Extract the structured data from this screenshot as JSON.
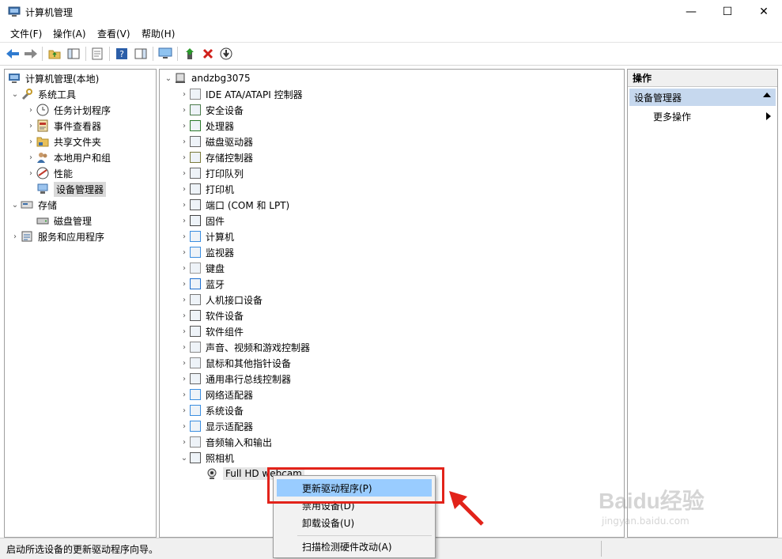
{
  "window": {
    "title": "计算机管理",
    "minimize_glyph": "—",
    "maximize_glyph": "☐",
    "close_glyph": "✕"
  },
  "menubar": {
    "items": [
      "文件(F)",
      "操作(A)",
      "查看(V)",
      "帮助(H)"
    ]
  },
  "toolbar": {
    "icons": [
      "back-icon",
      "forward-icon",
      "up-folder-icon",
      "show-tree-icon",
      "properties-icon",
      "help-icon",
      "show-action-pane-icon",
      "monitor-icon",
      "update-driver-icon",
      "uninstall-icon",
      "scan-hardware-icon"
    ]
  },
  "left_tree": {
    "root": "计算机管理(本地)",
    "system_tools": "系统工具",
    "task_scheduler": "任务计划程序",
    "event_viewer": "事件查看器",
    "shared_folders": "共享文件夹",
    "local_users": "本地用户和组",
    "performance": "性能",
    "device_manager": "设备管理器",
    "storage": "存储",
    "disk_management": "磁盘管理",
    "services": "服务和应用程序"
  },
  "device_tree": {
    "computer": "andzbg3075",
    "categories": [
      "IDE ATA/ATAPI 控制器",
      "安全设备",
      "处理器",
      "磁盘驱动器",
      "存储控制器",
      "打印队列",
      "打印机",
      "端口 (COM 和 LPT)",
      "固件",
      "计算机",
      "监视器",
      "键盘",
      "蓝牙",
      "人机接口设备",
      "软件设备",
      "软件组件",
      "声音、视频和游戏控制器",
      "鼠标和其他指针设备",
      "通用串行总线控制器",
      "网络适配器",
      "系统设备",
      "显示适配器",
      "音频输入和输出",
      "照相机"
    ],
    "child": "Full HD webcam"
  },
  "actions": {
    "header": "操作",
    "section": "设备管理器",
    "more": "更多操作"
  },
  "context_menu": {
    "items": [
      "更新驱动程序(P)",
      "禁用设备(D)",
      "卸载设备(U)",
      "扫描检测硬件改动(A)"
    ]
  },
  "status": {
    "text": "启动所选设备的更新驱动程序向导。"
  },
  "watermark": {
    "brand": "Baidu经验",
    "url": "jingyan.baidu.com"
  },
  "colors": {
    "highlight": "#99ccff",
    "annotation": "#e2231a",
    "action_header": "#c6d8ee"
  }
}
